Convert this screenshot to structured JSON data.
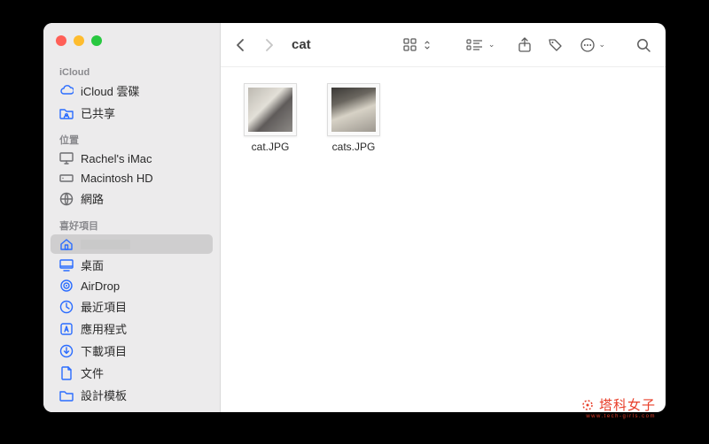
{
  "window": {
    "title": "cat"
  },
  "sidebar": {
    "sections": [
      {
        "header": "iCloud",
        "items": [
          {
            "id": "icloud-drive",
            "label": "iCloud 雲碟",
            "icon": "cloud"
          },
          {
            "id": "shared",
            "label": "已共享",
            "icon": "folder-shared"
          }
        ]
      },
      {
        "header": "位置",
        "items": [
          {
            "id": "imac",
            "label": "Rachel's iMac",
            "icon": "display"
          },
          {
            "id": "macintosh-hd",
            "label": "Macintosh HD",
            "icon": "drive"
          },
          {
            "id": "network",
            "label": "網路",
            "icon": "globe"
          }
        ]
      },
      {
        "header": "喜好項目",
        "items": [
          {
            "id": "home",
            "label": "",
            "icon": "house",
            "selected": true,
            "redacted": true
          },
          {
            "id": "desktop",
            "label": "桌面",
            "icon": "desktop"
          },
          {
            "id": "airdrop",
            "label": "AirDrop",
            "icon": "airdrop"
          },
          {
            "id": "recents",
            "label": "最近項目",
            "icon": "clock"
          },
          {
            "id": "applications",
            "label": "應用程式",
            "icon": "app"
          },
          {
            "id": "downloads",
            "label": "下載項目",
            "icon": "download"
          },
          {
            "id": "documents",
            "label": "文件",
            "icon": "doc"
          },
          {
            "id": "templates",
            "label": "設計模板",
            "icon": "folder"
          }
        ]
      }
    ]
  },
  "files": [
    {
      "name": "cat.JPG",
      "thumb": "a"
    },
    {
      "name": "cats.JPG",
      "thumb": "b"
    }
  ],
  "watermark": {
    "text": "塔科女子",
    "sub": "www.tech-girls.com"
  }
}
